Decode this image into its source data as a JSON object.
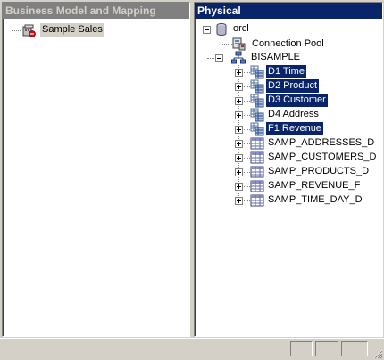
{
  "left_pane": {
    "title": "Business Model and Mapping",
    "items": [
      {
        "label": "Sample Sales",
        "icon": "business-model-icon"
      }
    ]
  },
  "right_pane": {
    "title": "Physical",
    "database": {
      "label": "orcl",
      "icon": "database-icon"
    },
    "connection_pool": {
      "label": "Connection Pool",
      "icon": "connection-pool-icon"
    },
    "schema": {
      "label": "BISAMPLE",
      "icon": "schema-icon"
    },
    "tables": [
      {
        "label": "D1 Time",
        "icon": "alias-table-icon",
        "selected": true
      },
      {
        "label": "D2 Product",
        "icon": "alias-table-icon",
        "selected": true
      },
      {
        "label": "D3 Customer",
        "icon": "alias-table-icon",
        "selected": true
      },
      {
        "label": "D4 Address",
        "icon": "alias-table-icon",
        "selected": false
      },
      {
        "label": "F1 Revenue",
        "icon": "alias-table-icon",
        "selected": true
      },
      {
        "label": "SAMP_ADDRESSES_D",
        "icon": "table-icon",
        "selected": false
      },
      {
        "label": "SAMP_CUSTOMERS_D",
        "icon": "table-icon",
        "selected": false
      },
      {
        "label": "SAMP_PRODUCTS_D",
        "icon": "table-icon",
        "selected": false
      },
      {
        "label": "SAMP_REVENUE_F",
        "icon": "table-icon",
        "selected": false
      },
      {
        "label": "SAMP_TIME_DAY_D",
        "icon": "table-icon",
        "selected": false
      }
    ]
  },
  "colors": {
    "active_title": "#0a246a",
    "inactive_title": "#808080",
    "selection": "#0a246a",
    "face": "#d4d0c8"
  }
}
